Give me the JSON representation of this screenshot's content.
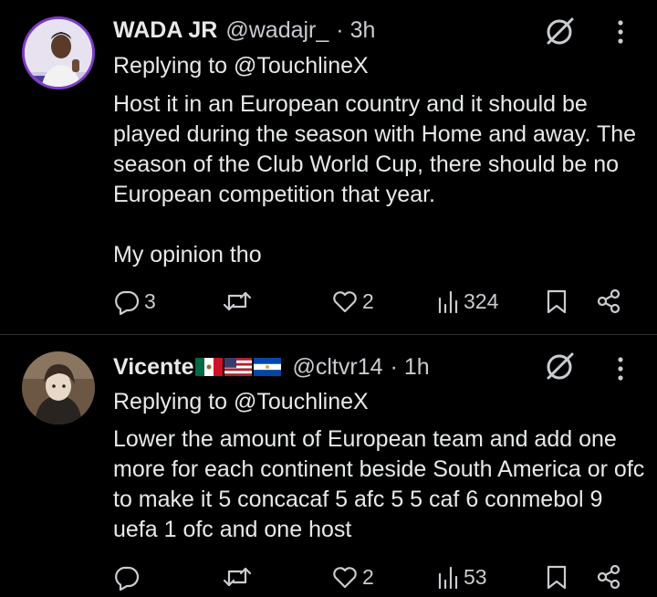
{
  "colors": {
    "background": "#000000",
    "text": "#e7e9ea",
    "secondary": "#c9ccd0",
    "divider": "#2f3336"
  },
  "tweets": [
    {
      "display_name": "WADA JR",
      "handle": "@wadajr_",
      "separator": "·",
      "time": "3h",
      "replying_to": "Replying to @TouchlineX",
      "paragraphs": [
        "Host it in an European country and it should be played during the season with Home and away. The season of the Club World Cup, there should be no European competition that year.",
        "My opinion tho"
      ],
      "replies": "3",
      "reposts": "",
      "likes": "2",
      "views": "324"
    },
    {
      "display_name": "Vicente",
      "flags": [
        "mexico-flag",
        "usa-flag",
        "el-salvador-flag"
      ],
      "handle": "@cltvr14",
      "separator": "·",
      "time": "1h",
      "replying_to": "Replying to @TouchlineX",
      "paragraphs": [
        "Lower the amount of European team and add one more for each continent beside South America or ofc to make it 5 concacaf 5 afc 5 5 caf 6 conmebol 9 uefa 1 ofc and one host"
      ],
      "replies": "",
      "reposts": "",
      "likes": "2",
      "views": "53"
    }
  ],
  "icons": [
    "grok-icon",
    "more-icon",
    "reply-icon",
    "repost-icon",
    "like-icon",
    "views-icon",
    "bookmark-icon",
    "share-icon"
  ]
}
